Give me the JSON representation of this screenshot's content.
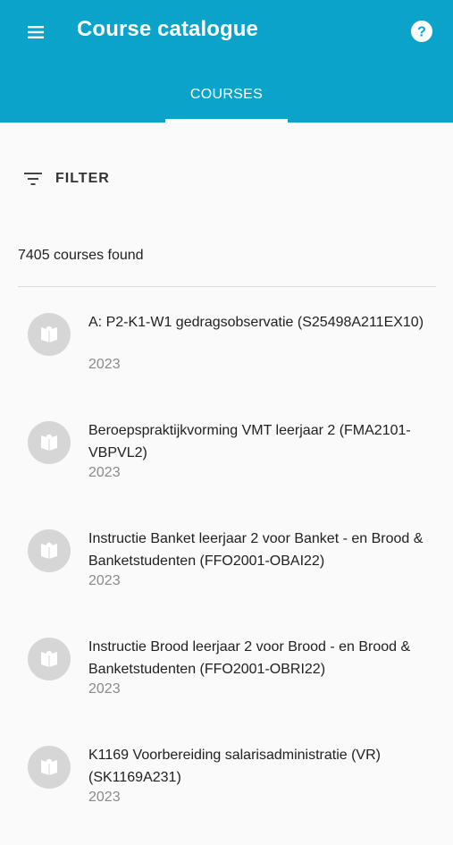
{
  "appbar": {
    "title": "Course catalogue",
    "background_color": "#0ba3c9",
    "menu_icon": "menu-icon",
    "help_icon": "help-icon"
  },
  "tabs": [
    {
      "label": "COURSES",
      "selected": true
    }
  ],
  "filter": {
    "label": "FILTER",
    "icon": "filter-icon"
  },
  "results": {
    "count_text": "7405 courses found"
  },
  "courses": [
    {
      "title": "A: P2-K1-W1 gedragsobservatie (S25498A211EX10)",
      "year": "2023",
      "icon": "open-book-icon"
    },
    {
      "title": "Beroepspraktijkvorming VMT leerjaar 2 (FMA2101-VBPVL2)",
      "year": "2023",
      "icon": "open-book-icon"
    },
    {
      "title": "Instructie Banket leerjaar 2 voor Banket - en Brood & Banketstudenten (FFO2001-OBAI22)",
      "year": "2023",
      "icon": "open-book-icon"
    },
    {
      "title": "Instructie Brood leerjaar 2 voor Brood - en Brood & Banketstudenten (FFO2001-OBRI22)",
      "year": "2023",
      "icon": "open-book-icon"
    },
    {
      "title": "K1169 Voorbereiding salarisadministratie (VR) (SK1169A231)",
      "year": "2023",
      "icon": "open-book-icon"
    }
  ]
}
